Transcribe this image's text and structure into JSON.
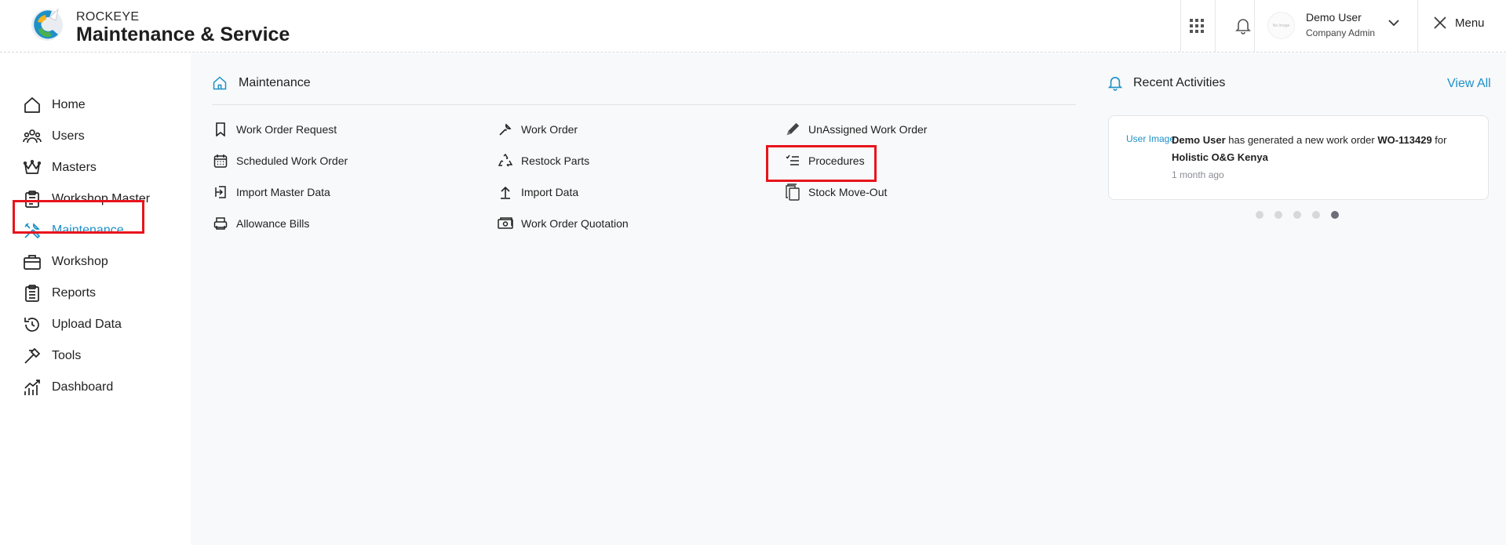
{
  "header": {
    "brand_small": "ROCKEYE",
    "brand_big": "Maintenance & Service",
    "avatar_text": "No Image",
    "user_name": "Demo User",
    "user_role": "Company Admin",
    "menu_label": "Menu"
  },
  "sidebar": {
    "items": [
      {
        "label": "Home",
        "icon": "home-icon"
      },
      {
        "label": "Users",
        "icon": "users-icon"
      },
      {
        "label": "Masters",
        "icon": "crown-icon"
      },
      {
        "label": "Workshop Master",
        "icon": "clipboard-icon"
      },
      {
        "label": "Maintenance",
        "icon": "tools-icon",
        "active": true
      },
      {
        "label": "Workshop",
        "icon": "briefcase-icon"
      },
      {
        "label": "Reports",
        "icon": "report-icon"
      },
      {
        "label": "Upload Data",
        "icon": "history-icon"
      },
      {
        "label": "Tools",
        "icon": "hammer-icon"
      },
      {
        "label": "Dashboard",
        "icon": "chart-icon"
      }
    ]
  },
  "main": {
    "section_title": "Maintenance",
    "links": [
      {
        "label": "Work Order Request",
        "icon": "bookmark-icon"
      },
      {
        "label": "Work Order",
        "icon": "wrench-icon"
      },
      {
        "label": "UnAssigned Work Order",
        "icon": "pencil-icon"
      },
      {
        "label": "Scheduled Work Order",
        "icon": "calendar-icon"
      },
      {
        "label": "Restock Parts",
        "icon": "recycle-icon"
      },
      {
        "label": "Procedures",
        "icon": "checklist-icon"
      },
      {
        "label": "Import Master Data",
        "icon": "import-icon"
      },
      {
        "label": "Import Data",
        "icon": "upload-icon"
      },
      {
        "label": "Stock Move-Out",
        "icon": "copy-icon"
      },
      {
        "label": "Allowance Bills",
        "icon": "printer-icon"
      },
      {
        "label": "Work Order Quotation",
        "icon": "money-icon"
      }
    ]
  },
  "recent": {
    "title": "Recent Activities",
    "view_all": "View All",
    "activity": {
      "img_alt": "User Image",
      "user": "Demo User",
      "text": " has generated a new work order ",
      "wo": "WO-113429",
      "for_text": " for",
      "company": "Holistic O&G Kenya",
      "time": "1 month ago"
    },
    "dots": 5,
    "active_dot": 5
  },
  "colors": {
    "accent": "#1e90c8",
    "highlight": "#e8141c",
    "main_bg": "#f8f9fa"
  }
}
